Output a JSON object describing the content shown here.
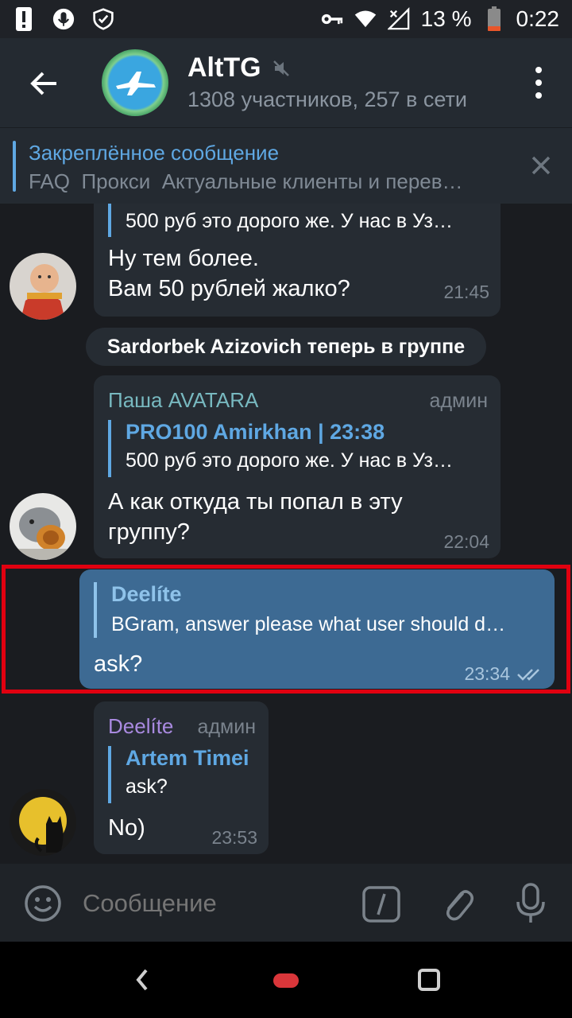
{
  "status_bar": {
    "battery_text": "13 %",
    "time": "0:22",
    "icons": [
      "alert-icon",
      "mic-status-icon",
      "shield-check-icon",
      "key-icon",
      "wifi-icon",
      "signal-off-icon",
      "battery-low-icon"
    ]
  },
  "header": {
    "title": "AltTG",
    "subtitle": "1308 участников, 257 в сети",
    "muted": true
  },
  "pinned": {
    "title": "Закреплённое сообщение",
    "text": "FAQ  Прокси  Актуальные клиенты и перев…"
  },
  "messages": [
    {
      "reply_text": "500 руб это дорого же. У нас в Уз…",
      "text_line1": "Ну тем более.",
      "text_line2": "Вам 50 рублей жалко?",
      "time": "21:45"
    },
    {
      "service": "Sardorbek Azizovich теперь в группе"
    },
    {
      "sender": "Паша AVATARA",
      "role": "админ",
      "reply_name": "PRO100 Amirkhan | 23:38",
      "reply_text": "500 руб это дорого же. У нас в Уз…",
      "text_line1": "А как откуда ты попал в эту",
      "text_line2": "группу?",
      "time": "22:04"
    },
    {
      "own": true,
      "reply_name": "Deelíte",
      "reply_text": "BGram, answer please what user should d…",
      "text": "ask?",
      "time": "23:34"
    },
    {
      "sender": "Deelíte",
      "role": "админ",
      "reply_name": "Artem Timei",
      "reply_text": "ask?",
      "text": "No)",
      "time": "23:53"
    }
  ],
  "input": {
    "placeholder": "Сообщение"
  },
  "colors": {
    "accent": "#5fa8e3",
    "own_bubble": "#3d6a93",
    "bubble": "#262c33",
    "highlight": "#e10010",
    "sender_pasha": "#78b9c0",
    "sender_deelite": "#a98ae0"
  }
}
